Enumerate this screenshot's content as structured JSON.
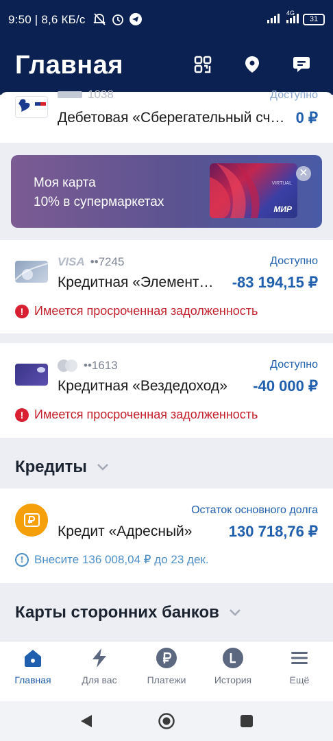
{
  "status_bar": {
    "time": "9:50 | 8,6 КБ/с",
    "network": "4G",
    "battery": "31"
  },
  "header": {
    "title": "Главная"
  },
  "debit_account": {
    "name": "Дебетовая «Сберегательный сч…",
    "amount": "0 ₽",
    "avail_label": "Доступно",
    "number_masked": "1038"
  },
  "promo": {
    "line1": "Моя карта",
    "line2": "10% в супермаркетах",
    "card_badge": "VIRTUAL",
    "card_brand": "МИР"
  },
  "cards": [
    {
      "brand": "VISA",
      "number": "••7245",
      "avail_label": "Доступно",
      "name": "Кредитная «Элемент…",
      "amount": "-83 194,15 ₽",
      "warning": "Имеется просроченная задолженность"
    },
    {
      "brand": "",
      "number": "••1613",
      "avail_label": "Доступно",
      "name": "Кредитная «Вездедоход»",
      "amount": "-40 000 ₽",
      "warning": "Имеется просроченная задолженность"
    }
  ],
  "credits": {
    "section_title": "Кредиты",
    "loan": {
      "balance_label": "Остаток основного долга",
      "name": "Кредит «Адресный»",
      "amount": "130 718,76 ₽",
      "payment_notice": "Внесите 136 008,04 ₽ до 23 дек."
    }
  },
  "other_banks": {
    "section_title": "Карты сторонних банков"
  },
  "bottom_nav": [
    {
      "label": "Главная",
      "icon": "home-icon",
      "active": true
    },
    {
      "label": "Для вас",
      "icon": "lightning-icon",
      "active": false
    },
    {
      "label": "Платежи",
      "icon": "ruble-icon",
      "active": false
    },
    {
      "label": "История",
      "icon": "history-icon",
      "active": false
    },
    {
      "label": "Ещё",
      "icon": "menu-icon",
      "active": false
    }
  ],
  "colors": {
    "header_bg": "#0b2151",
    "accent": "#1f5fae",
    "warning": "#c4202b",
    "loan_icon": "#f5a00a"
  }
}
